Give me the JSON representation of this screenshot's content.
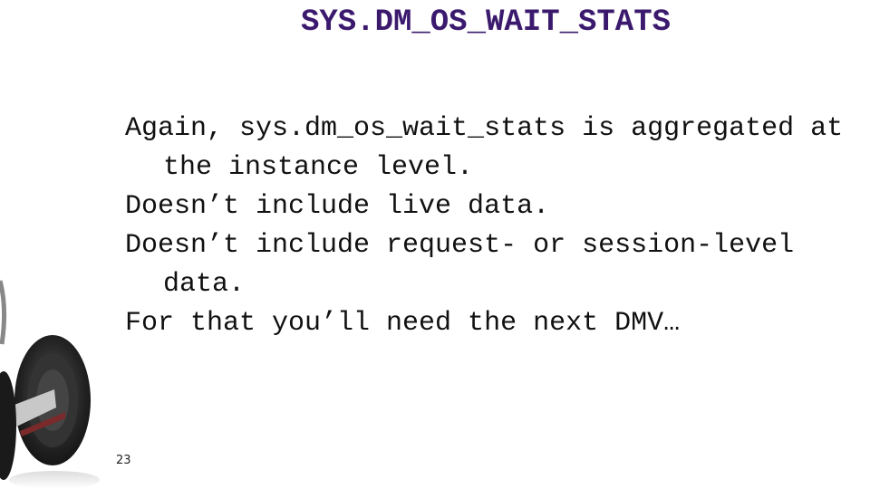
{
  "slide": {
    "title": "SYS.DM_OS_WAIT_STATS",
    "bullets": [
      "Again, sys.dm_os_wait_stats is aggregated at the instance level.",
      "Doesn’t include live data.",
      "Doesn’t include request- or session-level data.",
      "For that you’ll need the next DMV…"
    ],
    "page_number": "23",
    "image": "segway-icon"
  },
  "colors": {
    "title": "#3b1a6e",
    "body": "#111111",
    "background": "#ffffff"
  }
}
